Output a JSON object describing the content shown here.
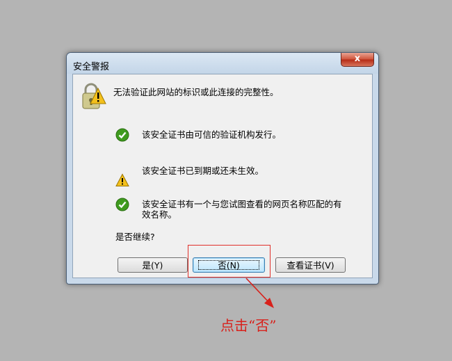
{
  "dialog": {
    "title": "安全警报",
    "close_label": "x",
    "header_message": "无法验证此网站的标识或此连接的完整性。",
    "items": [
      {
        "status": "ok",
        "text": "该安全证书由可信的验证机构发行。"
      },
      {
        "status": "warning",
        "text": "该安全证书已到期或还未生效。"
      },
      {
        "status": "ok",
        "text_line1": "该安全证书有一个与您试图查看的网页名称匹配的有",
        "text_line2": "效名称。"
      }
    ],
    "question": "是否继续?",
    "buttons": {
      "yes": "是(Y)",
      "no": "否(N)",
      "view_cert": "查看证书(V)"
    }
  },
  "annotation": {
    "text": "点击“否”",
    "color": "#d8211b"
  },
  "colors": {
    "ok_green": "#3f9b1e",
    "warning_yellow": "#f3c01c",
    "close_red": "#c8432b"
  }
}
